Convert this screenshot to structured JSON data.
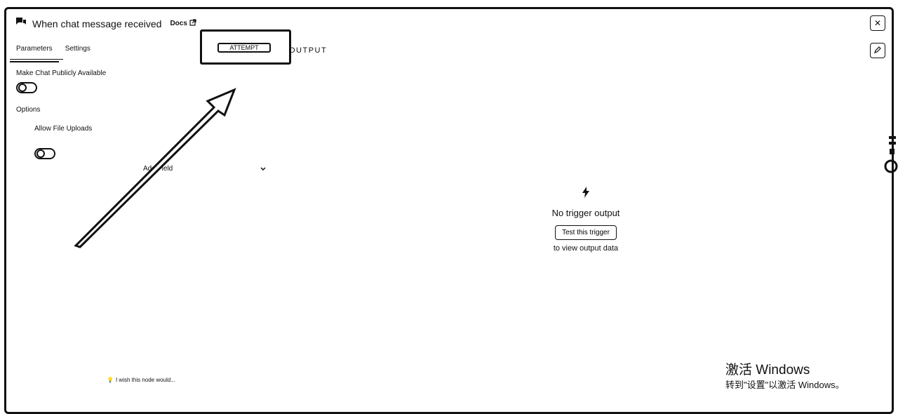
{
  "node": {
    "title": "When chat message received",
    "docs_label": "Docs"
  },
  "tabs": [
    {
      "label": "Parameters",
      "active": true
    },
    {
      "label": "Settings",
      "active": false
    }
  ],
  "params": {
    "make_public_label": "Make Chat Publicly Available",
    "make_public_value": false,
    "options_label": "Options",
    "allow_uploads_label": "Allow File Uploads",
    "allow_uploads_value": true,
    "add_field_label": "Add Field"
  },
  "output_tab": {
    "label": "OUTPUT",
    "highlight_label": "ATTEMPT"
  },
  "empty_state": {
    "title": "No trigger output",
    "button_label": "Test this trigger",
    "subtitle": "to view output data"
  },
  "feedback_label": "I wish this node would...",
  "watermark": {
    "title": "激活 Windows",
    "subtitle": "转到\"设置\"以激活 Windows。"
  },
  "icons": [
    "chat-icon",
    "external-link-icon",
    "close-icon",
    "pencil-icon",
    "bolt-icon",
    "chevron-down-icon",
    "bulb-icon"
  ]
}
